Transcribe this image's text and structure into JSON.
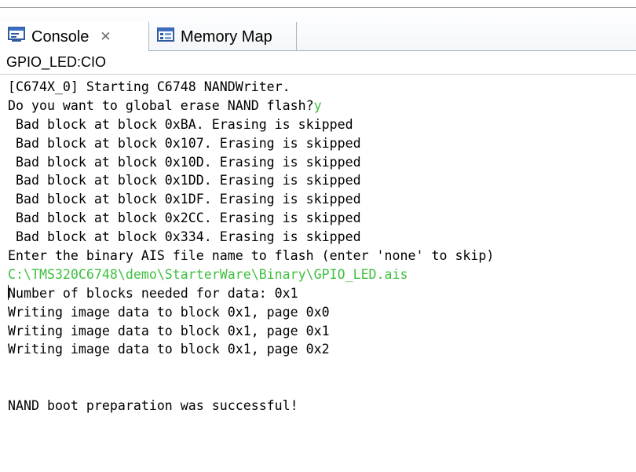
{
  "tabs": [
    {
      "label": "Console",
      "close_glyph": "✕",
      "icon": "console-icon"
    },
    {
      "label": "Memory Map",
      "icon": "memory-map-icon"
    }
  ],
  "view_title": "GPIO_LED:CIO",
  "console": {
    "lines": [
      {
        "text": "[C674X_0] Starting C6748 NANDWriter."
      },
      {
        "text": "Do you want to global erase NAND flash?",
        "input": "y"
      },
      {
        "text": " Bad block at block 0xBA. Erasing is skipped"
      },
      {
        "text": " Bad block at block 0x107. Erasing is skipped"
      },
      {
        "text": " Bad block at block 0x10D. Erasing is skipped"
      },
      {
        "text": " Bad block at block 0x1DD. Erasing is skipped"
      },
      {
        "text": " Bad block at block 0x1DF. Erasing is skipped"
      },
      {
        "text": " Bad block at block 0x2CC. Erasing is skipped"
      },
      {
        "text": " Bad block at block 0x334. Erasing is skipped"
      },
      {
        "text": "Enter the binary AIS file name to flash (enter 'none' to skip)"
      },
      {
        "text": "",
        "input": "C:\\TMS320C6748\\demo\\StarterWare\\Binary\\GPIO_LED.ais"
      },
      {
        "text": "Number of blocks needed for data: 0x1"
      },
      {
        "text": "Writing image data to block 0x1, page 0x0"
      },
      {
        "text": "Writing image data to block 0x1, page 0x1"
      },
      {
        "text": "Writing image data to block 0x1, page 0x2"
      },
      {
        "text": ""
      },
      {
        "text": ""
      },
      {
        "text": "NAND boot preparation was successful!"
      }
    ]
  },
  "colors": {
    "input_text": "#3fbf3f"
  }
}
